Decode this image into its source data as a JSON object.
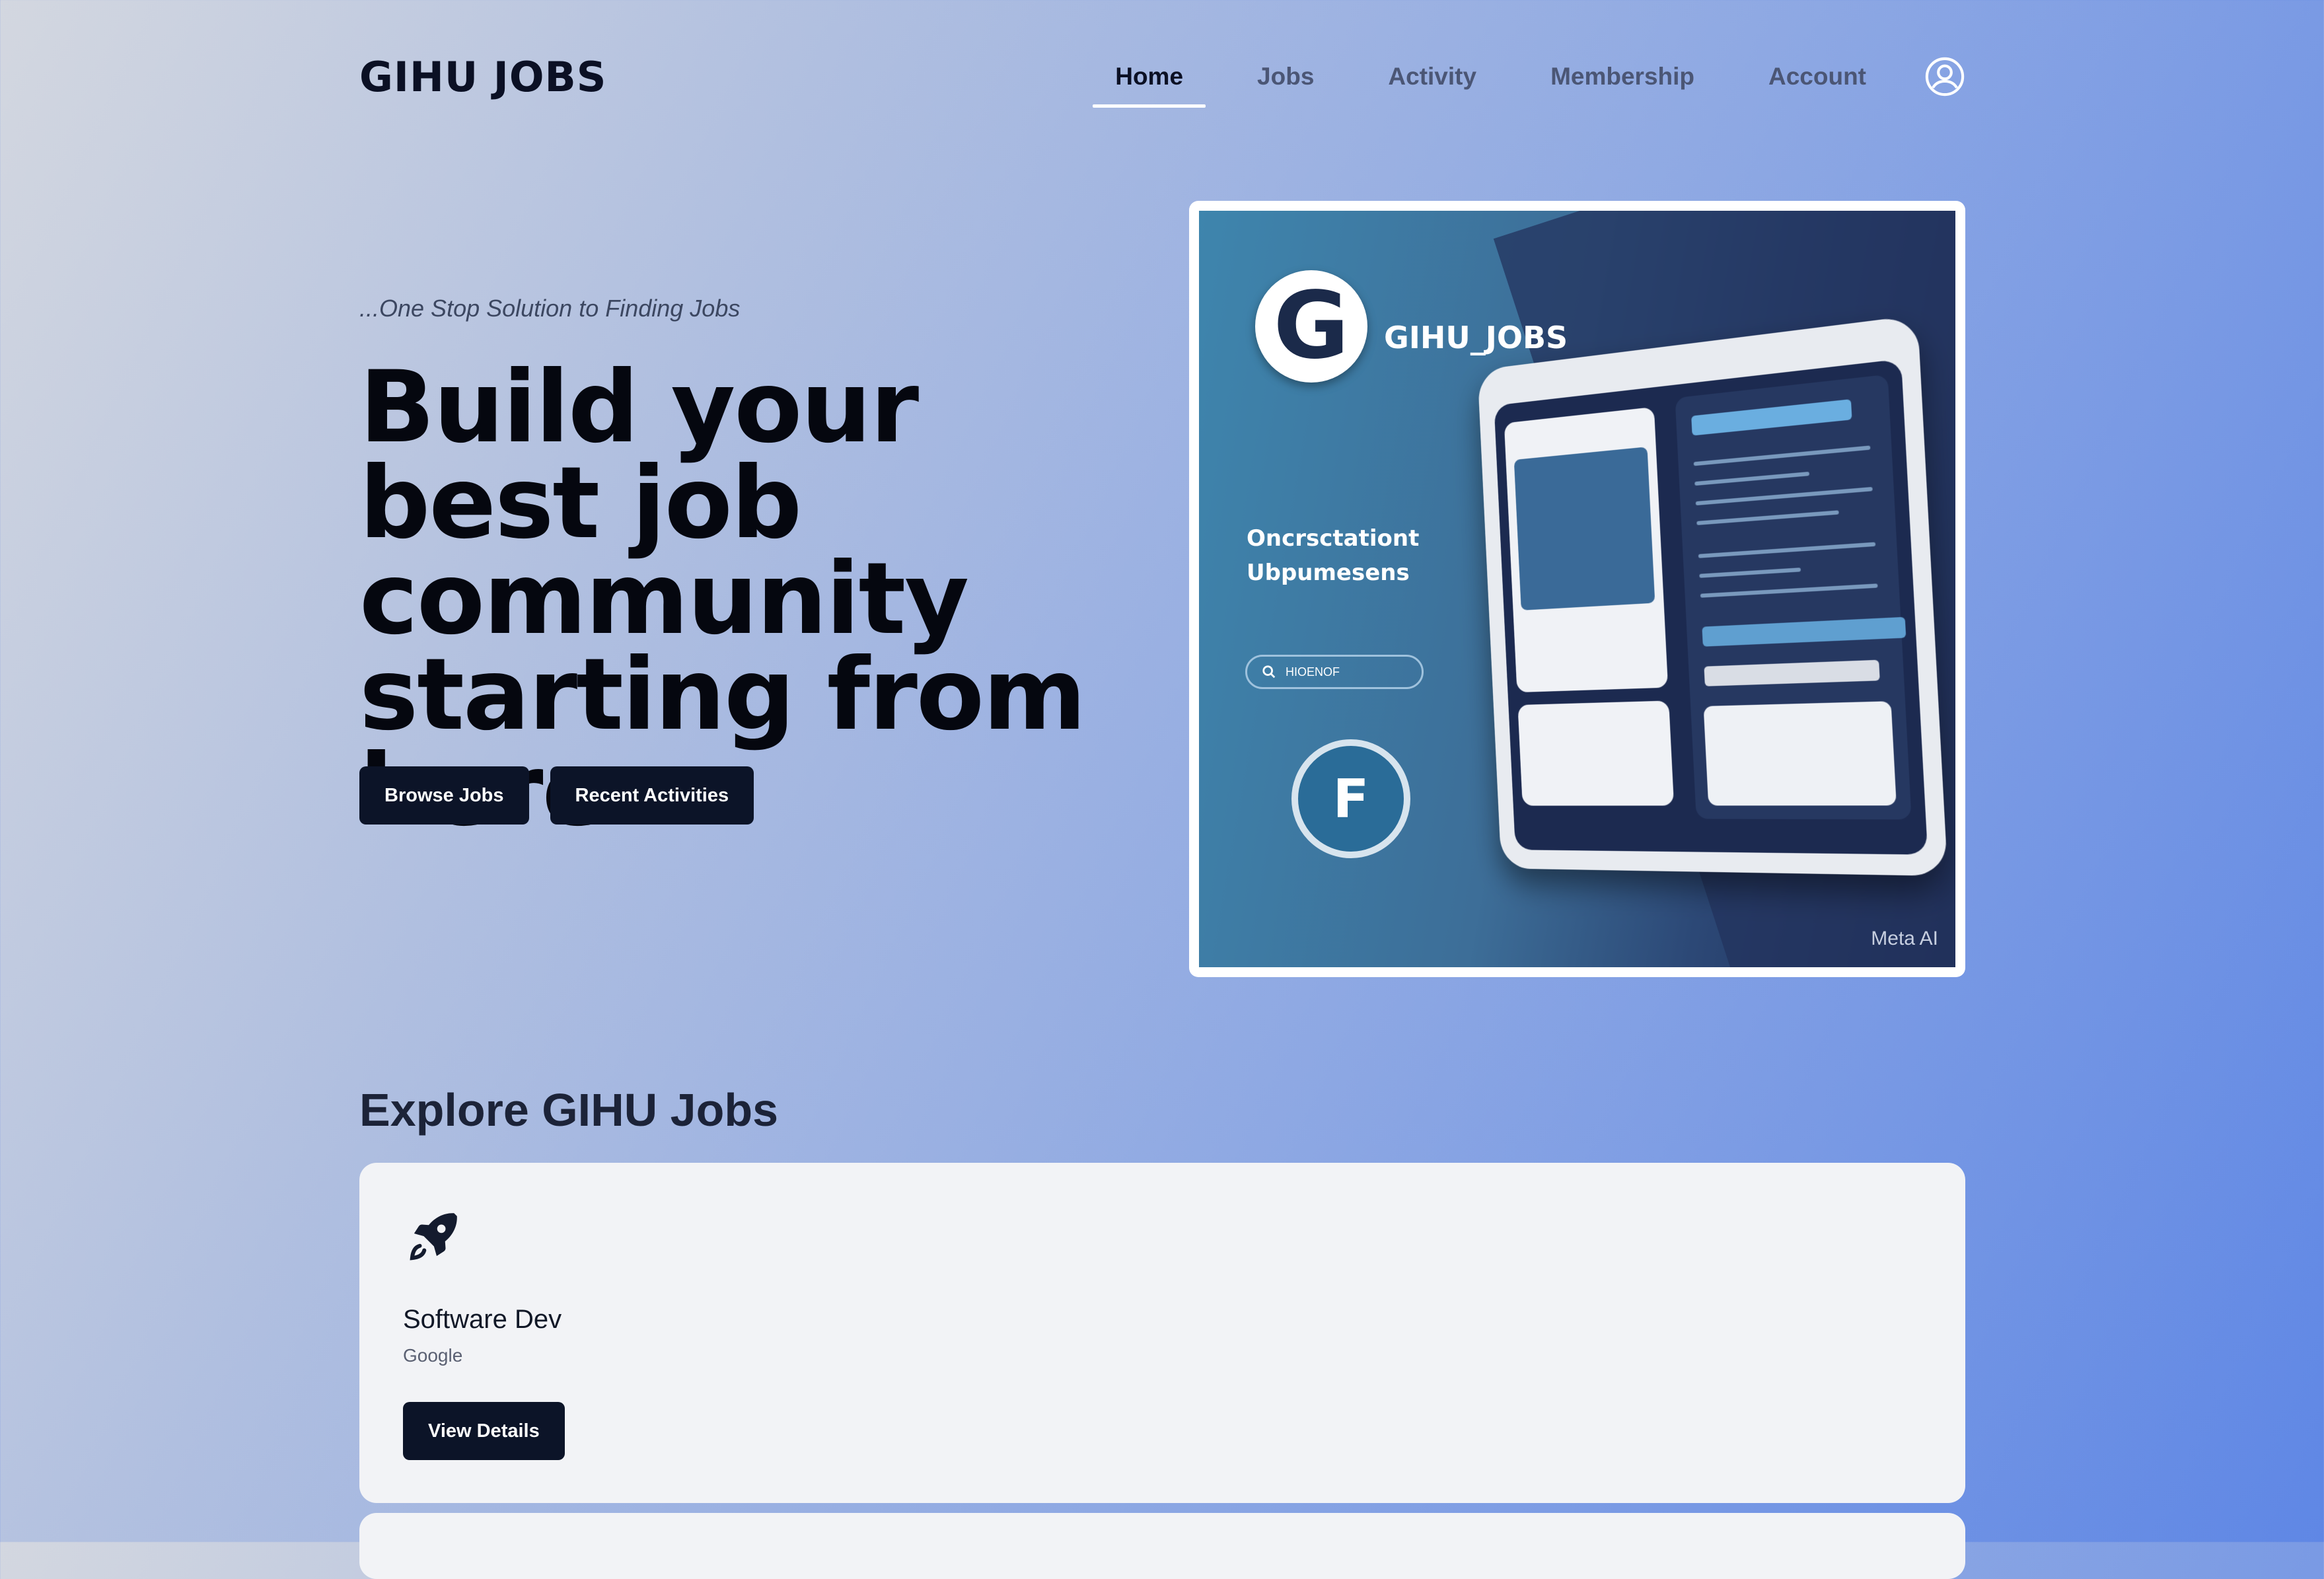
{
  "header": {
    "brand": "GIHU JOBS",
    "nav": [
      {
        "label": "Home",
        "active": true
      },
      {
        "label": "Jobs",
        "active": false
      },
      {
        "label": "Activity",
        "active": false
      },
      {
        "label": "Membership",
        "active": false
      },
      {
        "label": "Account",
        "active": false
      }
    ],
    "user_icon": "user-circle-icon"
  },
  "hero": {
    "tagline": "...One Stop Solution to Finding Jobs",
    "headline": "Build your best job community starting from here.",
    "buttons": {
      "browse": "Browse Jobs",
      "recent": "Recent Activities"
    },
    "image": {
      "brand": "GIHU_JOBS",
      "subtitle_line1": "Oncrsctationt",
      "subtitle_line2": "Ubpumesens",
      "search_text": "HIOENOF",
      "watermark": "Meta AI"
    }
  },
  "explore": {
    "title": "Explore GIHU Jobs",
    "jobs": [
      {
        "icon": "rocket-icon",
        "title": "Software Dev",
        "company": "Google",
        "button": "View Details"
      }
    ]
  },
  "colors": {
    "primary_button": "#0c1428",
    "card_background": "#f2f3f6"
  }
}
